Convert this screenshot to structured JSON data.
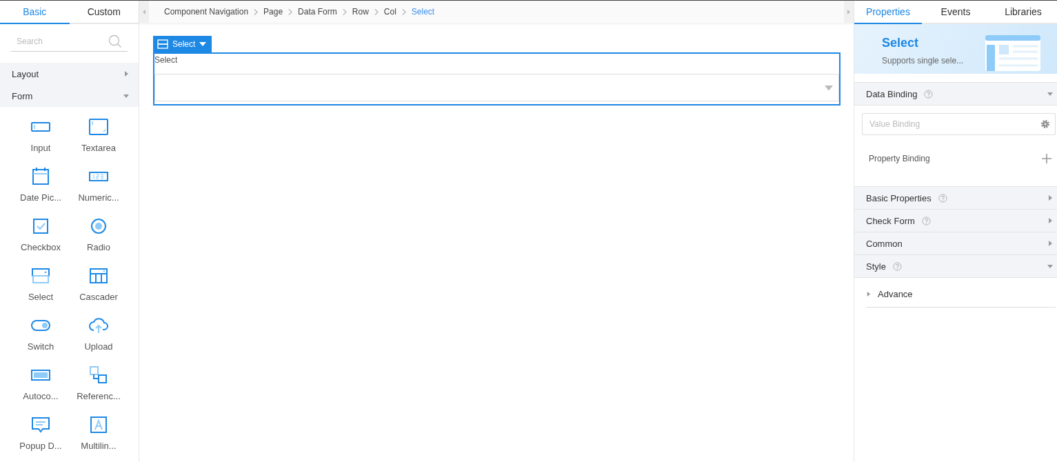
{
  "left_tabs": [
    {
      "label": "Basic",
      "selected": true
    },
    {
      "label": "Custom",
      "selected": false
    }
  ],
  "search": {
    "placeholder": "Search"
  },
  "categories": [
    {
      "label": "Layout",
      "expanded": false
    },
    {
      "label": "Form",
      "expanded": true
    }
  ],
  "components": [
    {
      "label": "Input",
      "kind": "input"
    },
    {
      "label": "Textarea",
      "kind": "textarea"
    },
    {
      "label": "Date Pic...",
      "kind": "date"
    },
    {
      "label": "Numeric...",
      "kind": "numeric"
    },
    {
      "label": "Checkbox",
      "kind": "checkbox"
    },
    {
      "label": "Radio",
      "kind": "radio"
    },
    {
      "label": "Select",
      "kind": "select"
    },
    {
      "label": "Cascader",
      "kind": "cascader"
    },
    {
      "label": "Switch",
      "kind": "switch"
    },
    {
      "label": "Upload",
      "kind": "upload"
    },
    {
      "label": "Autoco...",
      "kind": "autocomplete"
    },
    {
      "label": "Referenc...",
      "kind": "reference"
    },
    {
      "label": "Popup D...",
      "kind": "popup"
    },
    {
      "label": "Multilin...",
      "kind": "multilingual"
    }
  ],
  "breadcrumb": [
    {
      "label": "Component Navigation",
      "selected": false
    },
    {
      "label": "Page",
      "selected": false
    },
    {
      "label": "Data Form",
      "selected": false
    },
    {
      "label": "Row",
      "selected": false
    },
    {
      "label": "Col",
      "selected": false
    },
    {
      "label": "Select",
      "selected": true
    }
  ],
  "canvas": {
    "tag": "Select",
    "field_label": "Select"
  },
  "right_tabs": [
    {
      "label": "Properties",
      "selected": true
    },
    {
      "label": "Events",
      "selected": false
    },
    {
      "label": "Libraries",
      "selected": false
    }
  ],
  "banner": {
    "title": "Select",
    "subtitle": "Supports single sele..."
  },
  "sections": [
    {
      "label": "Data Binding",
      "help": true,
      "expanded": true
    },
    {
      "label": "Basic Properties",
      "help": true,
      "expanded": false
    },
    {
      "label": "Check Form",
      "help": true,
      "expanded": false
    },
    {
      "label": "Common",
      "help": false,
      "expanded": false
    },
    {
      "label": "Style",
      "help": true,
      "expanded": true
    }
  ],
  "value_binding": {
    "placeholder": "Value Binding"
  },
  "property_binding": "Property Binding",
  "advance": {
    "label": "Advance",
    "expanded": false
  }
}
